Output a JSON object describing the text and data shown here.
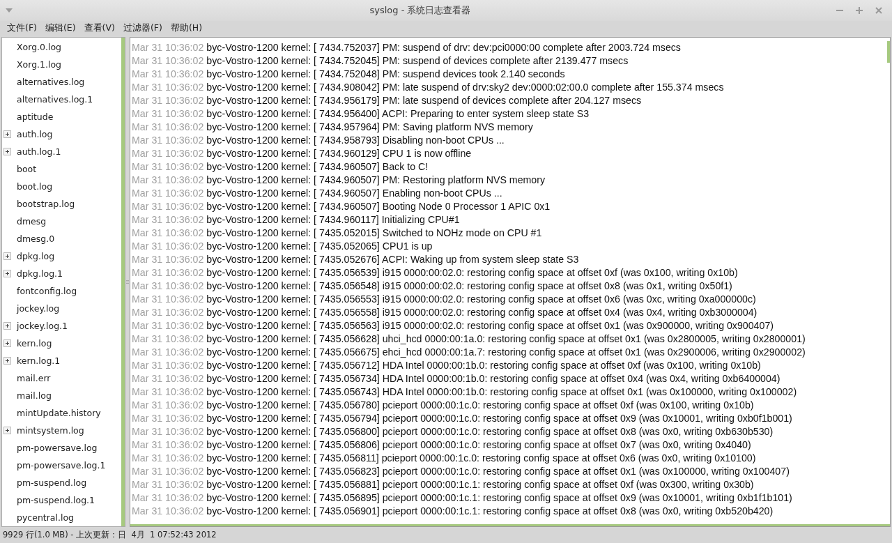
{
  "window": {
    "title": "syslog - 系统日志查看器"
  },
  "menu": [
    "文件(F)",
    "编辑(E)",
    "查看(V)",
    "过滤器(F)",
    "帮助(H)"
  ],
  "sidebar": {
    "items": [
      {
        "label": "Xorg.0.log",
        "kind": "file"
      },
      {
        "label": "Xorg.1.log",
        "kind": "file"
      },
      {
        "label": "alternatives.log",
        "kind": "file"
      },
      {
        "label": "alternatives.log.1",
        "kind": "file"
      },
      {
        "label": "aptitude",
        "kind": "file"
      },
      {
        "label": "auth.log",
        "kind": "group"
      },
      {
        "label": "auth.log.1",
        "kind": "group"
      },
      {
        "label": "boot",
        "kind": "file"
      },
      {
        "label": "boot.log",
        "kind": "file"
      },
      {
        "label": "bootstrap.log",
        "kind": "file"
      },
      {
        "label": "dmesg",
        "kind": "file"
      },
      {
        "label": "dmesg.0",
        "kind": "file"
      },
      {
        "label": "dpkg.log",
        "kind": "group"
      },
      {
        "label": "dpkg.log.1",
        "kind": "group"
      },
      {
        "label": "fontconfig.log",
        "kind": "file"
      },
      {
        "label": "jockey.log",
        "kind": "file"
      },
      {
        "label": "jockey.log.1",
        "kind": "group"
      },
      {
        "label": "kern.log",
        "kind": "group"
      },
      {
        "label": "kern.log.1",
        "kind": "group"
      },
      {
        "label": "mail.err",
        "kind": "file"
      },
      {
        "label": "mail.log",
        "kind": "file"
      },
      {
        "label": "mintUpdate.history",
        "kind": "file"
      },
      {
        "label": "mintsystem.log",
        "kind": "group"
      },
      {
        "label": "pm-powersave.log",
        "kind": "file"
      },
      {
        "label": "pm-powersave.log.1",
        "kind": "file"
      },
      {
        "label": "pm-suspend.log",
        "kind": "file"
      },
      {
        "label": "pm-suspend.log.1",
        "kind": "file"
      },
      {
        "label": "pycentral.log",
        "kind": "file"
      }
    ]
  },
  "log": {
    "lines": [
      {
        "time": "Mar 31 10:36:02",
        "text": "byc-Vostro-1200 kernel: [ 7434.752037] PM: suspend of drv: dev:pci0000:00 complete after 2003.724 msecs"
      },
      {
        "time": "Mar 31 10:36:02",
        "text": "byc-Vostro-1200 kernel: [ 7434.752045] PM: suspend of devices complete after 2139.477 msecs"
      },
      {
        "time": "Mar 31 10:36:02",
        "text": "byc-Vostro-1200 kernel: [ 7434.752048] PM: suspend devices took 2.140 seconds"
      },
      {
        "time": "Mar 31 10:36:02",
        "text": "byc-Vostro-1200 kernel: [ 7434.908042] PM: late suspend of drv:sky2 dev:0000:02:00.0 complete after 155.374 msecs"
      },
      {
        "time": "Mar 31 10:36:02",
        "text": "byc-Vostro-1200 kernel: [ 7434.956179] PM: late suspend of devices complete after 204.127 msecs"
      },
      {
        "time": "Mar 31 10:36:02",
        "text": "byc-Vostro-1200 kernel: [ 7434.956400] ACPI: Preparing to enter system sleep state S3"
      },
      {
        "time": "Mar 31 10:36:02",
        "text": "byc-Vostro-1200 kernel: [ 7434.957964] PM: Saving platform NVS memory"
      },
      {
        "time": "Mar 31 10:36:02",
        "text": "byc-Vostro-1200 kernel: [ 7434.958793] Disabling non-boot CPUs ..."
      },
      {
        "time": "Mar 31 10:36:02",
        "text": "byc-Vostro-1200 kernel: [ 7434.960129] CPU 1 is now offline"
      },
      {
        "time": "Mar 31 10:36:02",
        "text": "byc-Vostro-1200 kernel: [ 7434.960507] Back to C!"
      },
      {
        "time": "Mar 31 10:36:02",
        "text": "byc-Vostro-1200 kernel: [ 7434.960507] PM: Restoring platform NVS memory"
      },
      {
        "time": "Mar 31 10:36:02",
        "text": "byc-Vostro-1200 kernel: [ 7434.960507] Enabling non-boot CPUs ..."
      },
      {
        "time": "Mar 31 10:36:02",
        "text": "byc-Vostro-1200 kernel: [ 7434.960507] Booting Node 0 Processor 1 APIC 0x1"
      },
      {
        "time": "Mar 31 10:36:02",
        "text": "byc-Vostro-1200 kernel: [ 7434.960117] Initializing CPU#1"
      },
      {
        "time": "Mar 31 10:36:02",
        "text": "byc-Vostro-1200 kernel: [ 7435.052015] Switched to NOHz mode on CPU #1"
      },
      {
        "time": "Mar 31 10:36:02",
        "text": "byc-Vostro-1200 kernel: [ 7435.052065] CPU1 is up"
      },
      {
        "time": "Mar 31 10:36:02",
        "text": "byc-Vostro-1200 kernel: [ 7435.052676] ACPI: Waking up from system sleep state S3"
      },
      {
        "time": "Mar 31 10:36:02",
        "text": "byc-Vostro-1200 kernel: [ 7435.056539] i915 0000:00:02.0: restoring config space at offset 0xf (was 0x100, writing 0x10b)"
      },
      {
        "time": "Mar 31 10:36:02",
        "text": "byc-Vostro-1200 kernel: [ 7435.056548] i915 0000:00:02.0: restoring config space at offset 0x8 (was 0x1, writing 0x50f1)"
      },
      {
        "time": "Mar 31 10:36:02",
        "text": "byc-Vostro-1200 kernel: [ 7435.056553] i915 0000:00:02.0: restoring config space at offset 0x6 (was 0xc, writing 0xa000000c)"
      },
      {
        "time": "Mar 31 10:36:02",
        "text": "byc-Vostro-1200 kernel: [ 7435.056558] i915 0000:00:02.0: restoring config space at offset 0x4 (was 0x4, writing 0xb3000004)"
      },
      {
        "time": "Mar 31 10:36:02",
        "text": "byc-Vostro-1200 kernel: [ 7435.056563] i915 0000:00:02.0: restoring config space at offset 0x1 (was 0x900000, writing 0x900407)"
      },
      {
        "time": "Mar 31 10:36:02",
        "text": "byc-Vostro-1200 kernel: [ 7435.056628] uhci_hcd 0000:00:1a.0: restoring config space at offset 0x1 (was 0x2800005, writing 0x2800001)"
      },
      {
        "time": "Mar 31 10:36:02",
        "text": "byc-Vostro-1200 kernel: [ 7435.056675] ehci_hcd 0000:00:1a.7: restoring config space at offset 0x1 (was 0x2900006, writing 0x2900002)"
      },
      {
        "time": "Mar 31 10:36:02",
        "text": "byc-Vostro-1200 kernel: [ 7435.056712] HDA Intel 0000:00:1b.0: restoring config space at offset 0xf (was 0x100, writing 0x10b)"
      },
      {
        "time": "Mar 31 10:36:02",
        "text": "byc-Vostro-1200 kernel: [ 7435.056734] HDA Intel 0000:00:1b.0: restoring config space at offset 0x4 (was 0x4, writing 0xb6400004)"
      },
      {
        "time": "Mar 31 10:36:02",
        "text": "byc-Vostro-1200 kernel: [ 7435.056743] HDA Intel 0000:00:1b.0: restoring config space at offset 0x1 (was 0x100000, writing 0x100002)"
      },
      {
        "time": "Mar 31 10:36:02",
        "text": "byc-Vostro-1200 kernel: [ 7435.056780] pcieport 0000:00:1c.0: restoring config space at offset 0xf (was 0x100, writing 0x10b)"
      },
      {
        "time": "Mar 31 10:36:02",
        "text": "byc-Vostro-1200 kernel: [ 7435.056794] pcieport 0000:00:1c.0: restoring config space at offset 0x9 (was 0x10001, writing 0xb0f1b001)"
      },
      {
        "time": "Mar 31 10:36:02",
        "text": "byc-Vostro-1200 kernel: [ 7435.056800] pcieport 0000:00:1c.0: restoring config space at offset 0x8 (was 0x0, writing 0xb630b530)"
      },
      {
        "time": "Mar 31 10:36:02",
        "text": "byc-Vostro-1200 kernel: [ 7435.056806] pcieport 0000:00:1c.0: restoring config space at offset 0x7 (was 0x0, writing 0x4040)"
      },
      {
        "time": "Mar 31 10:36:02",
        "text": "byc-Vostro-1200 kernel: [ 7435.056811] pcieport 0000:00:1c.0: restoring config space at offset 0x6 (was 0x0, writing 0x10100)"
      },
      {
        "time": "Mar 31 10:36:02",
        "text": "byc-Vostro-1200 kernel: [ 7435.056823] pcieport 0000:00:1c.0: restoring config space at offset 0x1 (was 0x100000, writing 0x100407)"
      },
      {
        "time": "Mar 31 10:36:02",
        "text": "byc-Vostro-1200 kernel: [ 7435.056881] pcieport 0000:00:1c.1: restoring config space at offset 0xf (was 0x300, writing 0x30b)"
      },
      {
        "time": "Mar 31 10:36:02",
        "text": "byc-Vostro-1200 kernel: [ 7435.056895] pcieport 0000:00:1c.1: restoring config space at offset 0x9 (was 0x10001, writing 0xb1f1b101)"
      },
      {
        "time": "Mar 31 10:36:02",
        "text": "byc-Vostro-1200 kernel: [ 7435.056901] pcieport 0000:00:1c.1: restoring config space at offset 0x8 (was 0x0, writing 0xb520b420)"
      }
    ]
  },
  "status_bar": "9929 行(1.0 MB) - 上次更新：日  4月  1 07:52:43 2012"
}
